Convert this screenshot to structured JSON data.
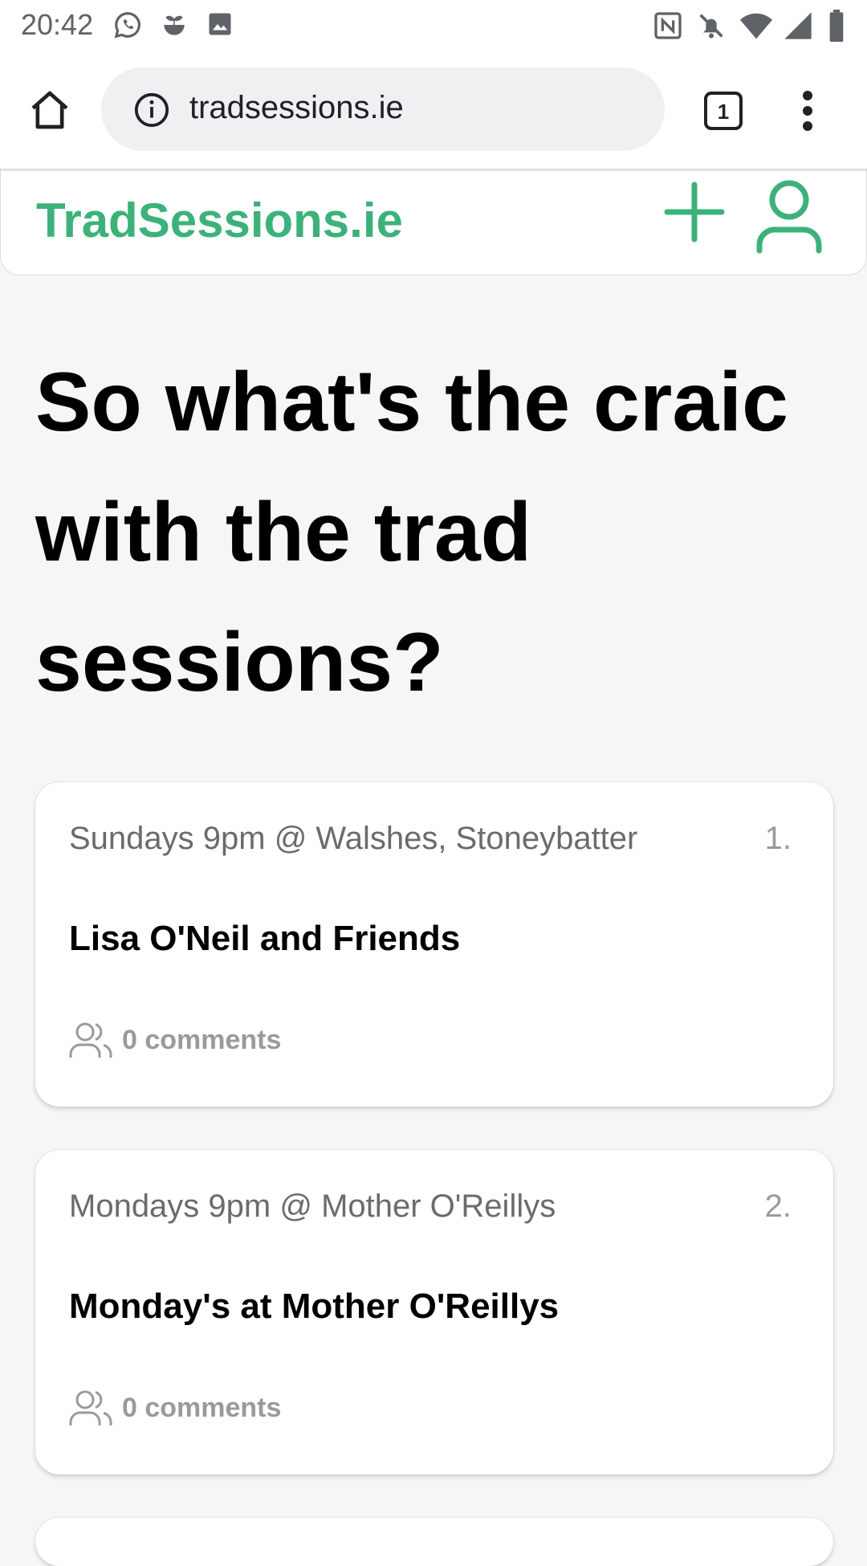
{
  "status_bar": {
    "time": "20:42",
    "left_icons": [
      "whatsapp-icon",
      "sprout-icon",
      "image-icon"
    ],
    "right_icons": [
      "nfc-icon",
      "bell-off-icon",
      "wifi-icon",
      "signal-icon",
      "battery-icon"
    ]
  },
  "browser": {
    "url": "tradsessions.ie",
    "tab_count": "1"
  },
  "site": {
    "logo": "TradSessions.ie",
    "brand_color": "#3cb27a"
  },
  "hero": {
    "heading": "So what's the craic with the trad sessions?"
  },
  "sessions": [
    {
      "when": "Sundays 9pm @ Walshes, Stoneybatter",
      "rank": "1.",
      "title": "Lisa O'Neil and Friends",
      "comments": "0 comments"
    },
    {
      "when": "Mondays 9pm @ Mother O'Reillys",
      "rank": "2.",
      "title": "Monday's at Mother O'Reillys",
      "comments": "0 comments"
    }
  ]
}
